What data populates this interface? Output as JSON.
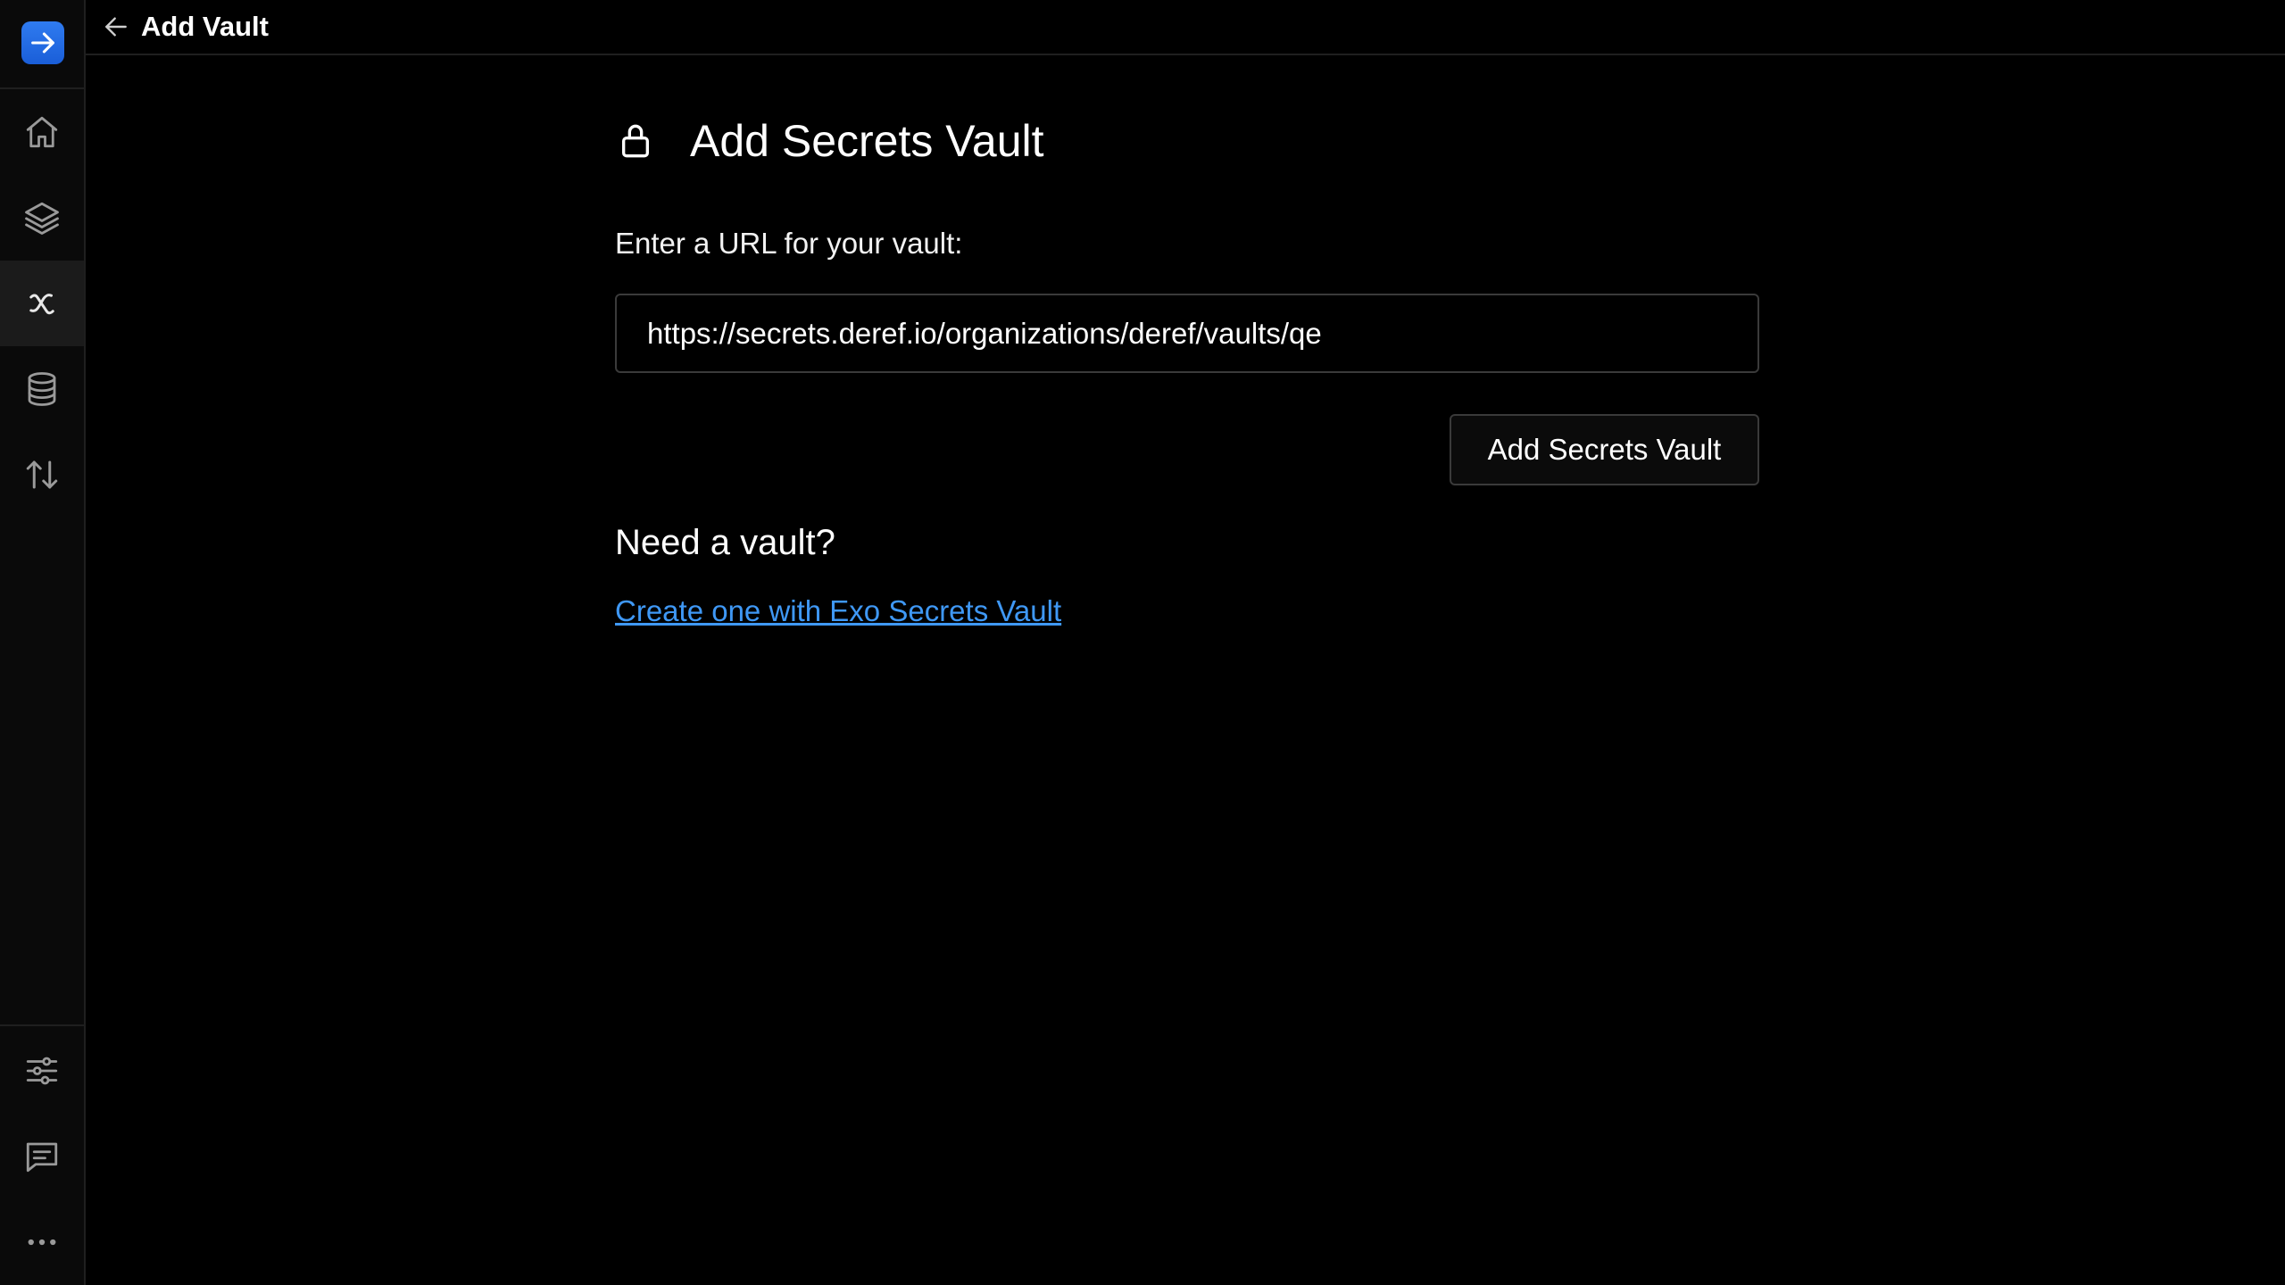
{
  "header": {
    "title": "Add Vault"
  },
  "sidebar": {
    "logo_icon": "arrow-right-icon",
    "logo_color": "#1f6ae6",
    "items": [
      {
        "name": "home",
        "icon": "home-icon"
      },
      {
        "name": "layers",
        "icon": "layers-icon"
      },
      {
        "name": "variables",
        "icon": "variable-x-icon",
        "active": true
      },
      {
        "name": "database",
        "icon": "database-icon"
      },
      {
        "name": "transfer",
        "icon": "arrows-up-down-icon"
      }
    ],
    "bottom_items": [
      {
        "name": "settings",
        "icon": "sliders-icon"
      },
      {
        "name": "feedback",
        "icon": "message-icon"
      },
      {
        "name": "more",
        "icon": "more-horizontal-icon"
      }
    ]
  },
  "main": {
    "title": "Add Secrets Vault",
    "url_label": "Enter a URL for your vault:",
    "url_value": "https://secrets.deref.io/organizations/deref/vaults/qe",
    "submit_label": "Add Secrets Vault",
    "need_heading": "Need a vault?",
    "create_link": "Create one with Exo Secrets Vault"
  },
  "colors": {
    "background": "#000000",
    "sidebar_background": "#0a0a0a",
    "active_item": "#1b1b1b",
    "link": "#3f98f5",
    "border": "#3a3a3a"
  }
}
